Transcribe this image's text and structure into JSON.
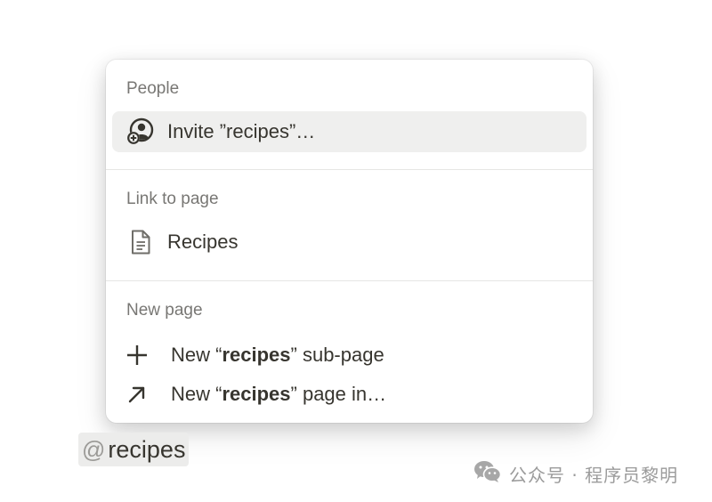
{
  "menu": {
    "sections": {
      "people": {
        "title": "People",
        "items": [
          {
            "label": "Invite ”recipes”…",
            "icon": "add-person-icon"
          }
        ]
      },
      "link_to_page": {
        "title": "Link to page",
        "items": [
          {
            "label": "Recipes",
            "icon": "page-document-icon"
          }
        ]
      },
      "new_page": {
        "title": "New page",
        "items": [
          {
            "prefix": "New “",
            "bold": "recipes",
            "suffix": "” sub-page",
            "icon": "plus-icon"
          },
          {
            "prefix": "New “",
            "bold": "recipes",
            "suffix": "” page in…",
            "icon": "arrow-up-right-icon"
          }
        ]
      }
    }
  },
  "mention": {
    "at_symbol": "@",
    "query": "recipes"
  },
  "watermark": {
    "text": "公众号 · 程序员黎明",
    "icon": "wechat-logo-icon"
  },
  "colors": {
    "selected_bg": "#efefee",
    "text": "#37352f",
    "muted": "#787774",
    "mention_bg": "#ececeb"
  }
}
